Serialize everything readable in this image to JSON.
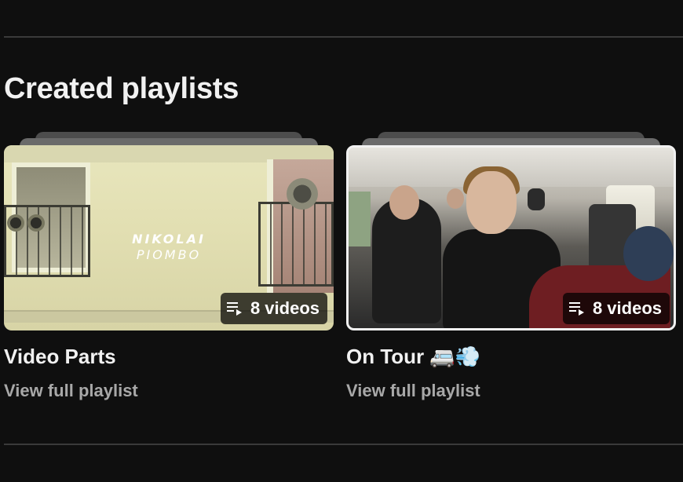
{
  "section": {
    "title": "Created playlists"
  },
  "playlists": [
    {
      "title": "Video Parts",
      "video_count": "8 videos",
      "link_label": "View full playlist",
      "thumbnail_text_line1": "NIKOLAI",
      "thumbnail_text_line2": "PIOMBO",
      "selected": false
    },
    {
      "title": "On Tour 🚐💨",
      "video_count": "8 videos",
      "link_label": "View full playlist",
      "selected": true
    }
  ],
  "colors": {
    "background": "#0f0f0f",
    "primary_text": "#f1f1f1",
    "secondary_text": "#a8a8a8",
    "divider": "#3a3a3a"
  },
  "icons": {
    "count_badge": "playlist-queue-icon"
  }
}
